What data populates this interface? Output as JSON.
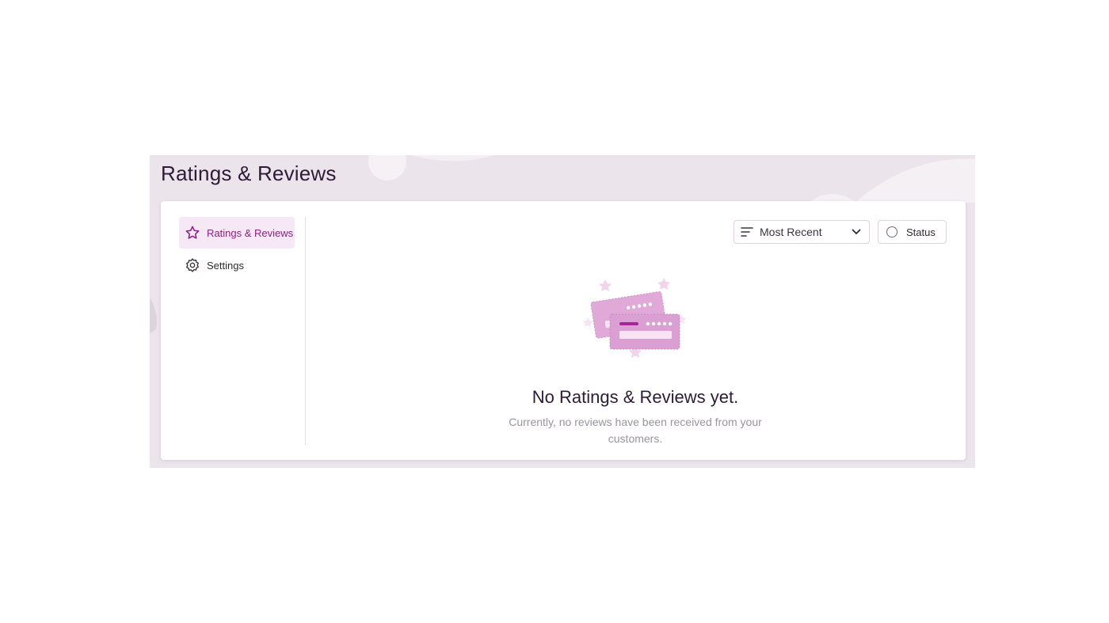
{
  "header": {
    "title": "Ratings & Reviews"
  },
  "sidebar": {
    "items": [
      {
        "label": "Ratings & Reviews",
        "icon": "star-icon",
        "active": true
      },
      {
        "label": "Settings",
        "icon": "gear-icon",
        "active": false
      }
    ]
  },
  "toolbar": {
    "sort": {
      "label": "Most Recent",
      "icon": "sort-lines-icon",
      "caret": "chevron-down-icon"
    },
    "status": {
      "label": "Status",
      "icon": "circle-icon"
    }
  },
  "empty_state": {
    "title": "No Ratings & Reviews yet.",
    "text": "Currently, no reviews have been received from your customers."
  },
  "colors": {
    "accent": "#8e1f86",
    "active_bg": "#f6e8f4",
    "page_bg": "#ebe4ea",
    "illustration_pink": "#e0a9d8"
  }
}
